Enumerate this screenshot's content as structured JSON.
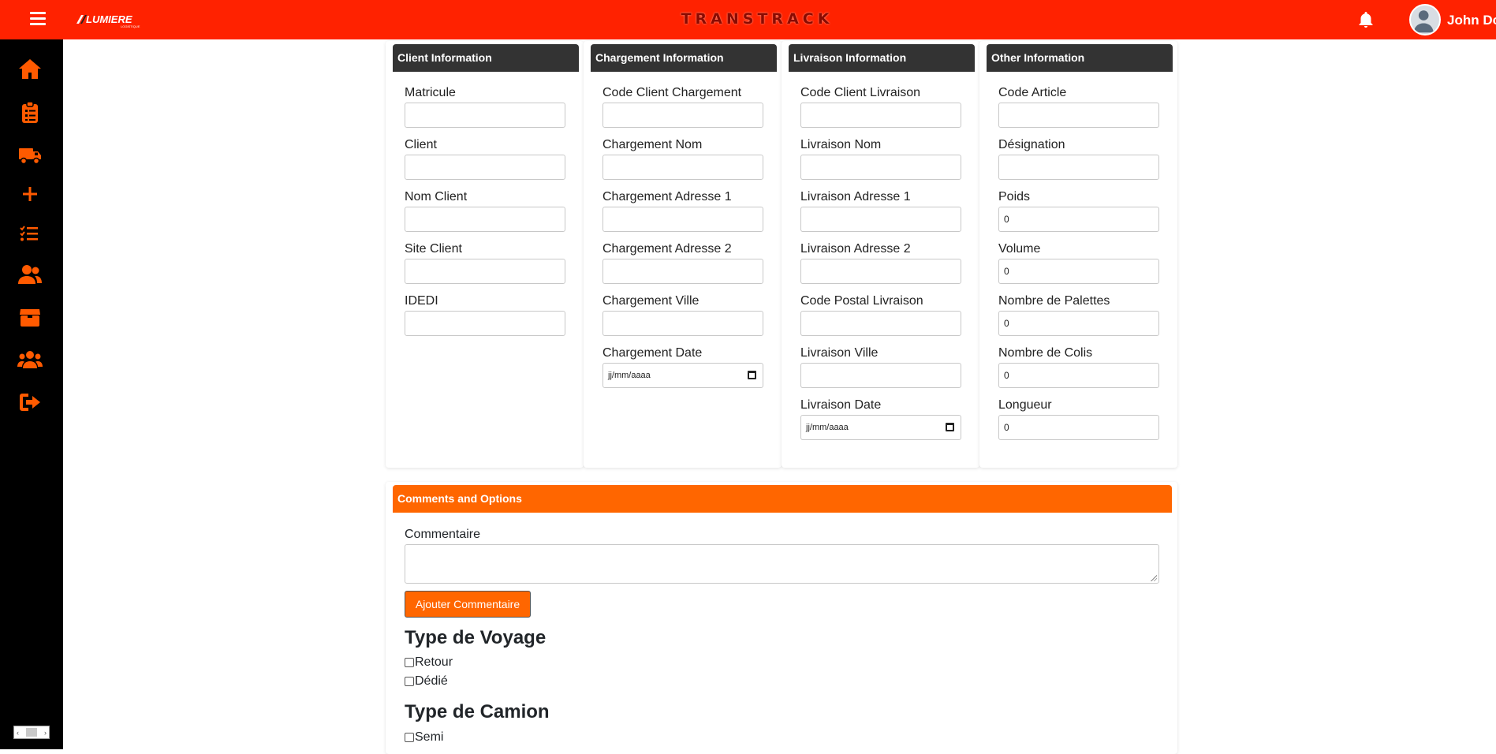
{
  "topbar": {
    "brand": "TRANSTRACK",
    "logo_text": "LUMIERE",
    "logo_sub": "LOGISTIQUE",
    "username": "John Doe",
    "bg_color": "#ff2200"
  },
  "sidebar": {
    "icons": [
      "home-icon",
      "clipboard-list-icon",
      "truck-icon",
      "plus-icon",
      "task-list-icon",
      "user-friends-icon",
      "box-icon",
      "users-icon",
      "logout-icon"
    ],
    "icon_color": "#ff5a00"
  },
  "client": {
    "header": "Client Information",
    "fields": [
      {
        "label": "Matricule",
        "value": ""
      },
      {
        "label": "Client",
        "value": ""
      },
      {
        "label": "Nom Client",
        "value": ""
      },
      {
        "label": "Site Client",
        "value": ""
      },
      {
        "label": "IDEDI",
        "value": ""
      }
    ]
  },
  "chargement": {
    "header": "Chargement Information",
    "fields": [
      {
        "label": "Code Client Chargement",
        "value": ""
      },
      {
        "label": "Chargement Nom",
        "value": ""
      },
      {
        "label": "Chargement Adresse 1",
        "value": ""
      },
      {
        "label": "Chargement Adresse 2",
        "value": ""
      },
      {
        "label": "Chargement Ville",
        "value": ""
      },
      {
        "label": "Chargement Date",
        "value": "jj/mm/aaaa"
      }
    ]
  },
  "livraison": {
    "header": "Livraison Information",
    "fields": [
      {
        "label": "Code Client Livraison",
        "value": ""
      },
      {
        "label": "Livraison Nom",
        "value": ""
      },
      {
        "label": "Livraison Adresse 1",
        "value": ""
      },
      {
        "label": "Livraison Adresse 2",
        "value": ""
      },
      {
        "label": "Code Postal Livraison",
        "value": ""
      },
      {
        "label": "Livraison Ville",
        "value": ""
      },
      {
        "label": "Livraison Date",
        "value": "jj/mm/aaaa"
      }
    ]
  },
  "other": {
    "header": "Other Information",
    "fields": [
      {
        "label": "Code Article",
        "value": ""
      },
      {
        "label": "Désignation",
        "value": ""
      },
      {
        "label": "Poids",
        "value": "0"
      },
      {
        "label": "Volume",
        "value": "0"
      },
      {
        "label": "Nombre de Palettes",
        "value": "0"
      },
      {
        "label": "Nombre de Colis",
        "value": "0"
      },
      {
        "label": "Longueur",
        "value": "0"
      }
    ]
  },
  "comments": {
    "header": "Comments and Options",
    "label": "Commentaire",
    "value": "",
    "button": "Ajouter Commentaire",
    "voyage_title": "Type de Voyage",
    "voyage_options": [
      "Retour",
      "Dédié"
    ],
    "camion_title": "Type de Camion",
    "camion_options": [
      "Semi"
    ]
  }
}
